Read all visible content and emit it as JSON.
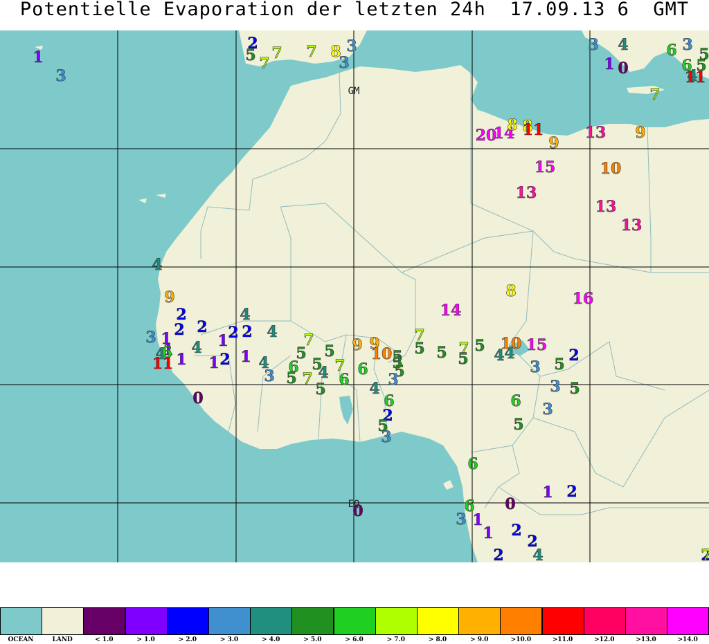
{
  "title": "Potentielle Evaporation der letzten 24h  17.09.13 6  GMT",
  "colors": {
    "ocean": "#7ecacb",
    "land": "#f1f0d9",
    "border": "#8fbcc0",
    "grid": "#000000"
  },
  "map_labels": [
    {
      "text": "GM"
    },
    {
      "text": "EQ"
    }
  ],
  "legend": [
    {
      "label": "OCEAN",
      "color": "#7ecacb"
    },
    {
      "label": "LAND",
      "color": "#f1f0d9"
    },
    {
      "label": "< 1.0",
      "color": "#660066"
    },
    {
      "label": "> 1.0",
      "color": "#8000ff"
    },
    {
      "label": "> 2.0",
      "color": "#0000ff"
    },
    {
      "label": "> 3.0",
      "color": "#4090d0"
    },
    {
      "label": "> 4.0",
      "color": "#208f80"
    },
    {
      "label": "> 5.0",
      "color": "#209020"
    },
    {
      "label": "> 6.0",
      "color": "#20d020"
    },
    {
      "label": "> 7.0",
      "color": "#b0ff00"
    },
    {
      "label": "> 8.0",
      "color": "#ffff00"
    },
    {
      "label": "> 9.0",
      "color": "#ffb000"
    },
    {
      "label": ">10.0",
      "color": "#ff8000"
    },
    {
      "label": ">11.0",
      "color": "#ff0000"
    },
    {
      "label": ">12.0",
      "color": "#ff0060"
    },
    {
      "label": ">13.0",
      "color": "#ff10a0"
    },
    {
      "label": ">14.0",
      "color": "#ff00ff"
    }
  ],
  "stations": [
    {
      "v": "1"
    },
    {
      "v": "3"
    },
    {
      "v": "2"
    },
    {
      "v": "5"
    },
    {
      "v": "7"
    },
    {
      "v": "7"
    },
    {
      "v": "7"
    },
    {
      "v": "8"
    },
    {
      "v": "3"
    },
    {
      "v": "3"
    },
    {
      "v": "3"
    },
    {
      "v": "4"
    },
    {
      "v": "1"
    },
    {
      "v": "0"
    },
    {
      "v": "6"
    },
    {
      "v": "3"
    },
    {
      "v": "5"
    },
    {
      "v": "6"
    },
    {
      "v": "4"
    },
    {
      "v": "5"
    },
    {
      "v": "11"
    },
    {
      "v": "7"
    },
    {
      "v": "20"
    },
    {
      "v": "14"
    },
    {
      "v": "8"
    },
    {
      "v": "8"
    },
    {
      "v": "11"
    },
    {
      "v": "9"
    },
    {
      "v": "13"
    },
    {
      "v": "9"
    },
    {
      "v": "15"
    },
    {
      "v": "10"
    },
    {
      "v": "13"
    },
    {
      "v": "13"
    },
    {
      "v": "13"
    },
    {
      "v": "4"
    },
    {
      "v": "9"
    },
    {
      "v": "2"
    },
    {
      "v": "4"
    },
    {
      "v": "2"
    },
    {
      "v": "2"
    },
    {
      "v": "3"
    },
    {
      "v": "1"
    },
    {
      "v": "1"
    },
    {
      "v": "2"
    },
    {
      "v": "2"
    },
    {
      "v": "1"
    },
    {
      "v": "4"
    },
    {
      "v": "4"
    },
    {
      "v": "6"
    },
    {
      "v": "11"
    },
    {
      "v": "1"
    },
    {
      "v": "4"
    },
    {
      "v": "1"
    },
    {
      "v": "2"
    },
    {
      "v": "1"
    },
    {
      "v": "4"
    },
    {
      "v": "3"
    },
    {
      "v": "0"
    },
    {
      "v": "14"
    },
    {
      "v": "8"
    },
    {
      "v": "16"
    },
    {
      "v": "7"
    },
    {
      "v": "5"
    },
    {
      "v": "5"
    },
    {
      "v": "9"
    },
    {
      "v": "9"
    },
    {
      "v": "10"
    },
    {
      "v": "5"
    },
    {
      "v": "7"
    },
    {
      "v": "5"
    },
    {
      "v": "5"
    },
    {
      "v": "7"
    },
    {
      "v": "5"
    },
    {
      "v": "5"
    },
    {
      "v": "10"
    },
    {
      "v": "15"
    },
    {
      "v": "4"
    },
    {
      "v": "4"
    },
    {
      "v": "2"
    },
    {
      "v": "6"
    },
    {
      "v": "5"
    },
    {
      "v": "7"
    },
    {
      "v": "7"
    },
    {
      "v": "5"
    },
    {
      "v": "4"
    },
    {
      "v": "5"
    },
    {
      "v": "6"
    },
    {
      "v": "6"
    },
    {
      "v": "5"
    },
    {
      "v": "3"
    },
    {
      "v": "5"
    },
    {
      "v": "4"
    },
    {
      "v": "6"
    },
    {
      "v": "2"
    },
    {
      "v": "5"
    },
    {
      "v": "3"
    },
    {
      "v": "3"
    },
    {
      "v": "3"
    },
    {
      "v": "5"
    },
    {
      "v": "5"
    },
    {
      "v": "6"
    },
    {
      "v": "5"
    },
    {
      "v": "3"
    },
    {
      "v": "6"
    },
    {
      "v": "1"
    },
    {
      "v": "2"
    },
    {
      "v": "6"
    },
    {
      "v": "0"
    },
    {
      "v": "3"
    },
    {
      "v": "1"
    },
    {
      "v": "1"
    },
    {
      "v": "2"
    },
    {
      "v": "2"
    },
    {
      "v": "0"
    },
    {
      "v": "2"
    },
    {
      "v": "4"
    },
    {
      "v": "2"
    },
    {
      "v": "7"
    }
  ]
}
